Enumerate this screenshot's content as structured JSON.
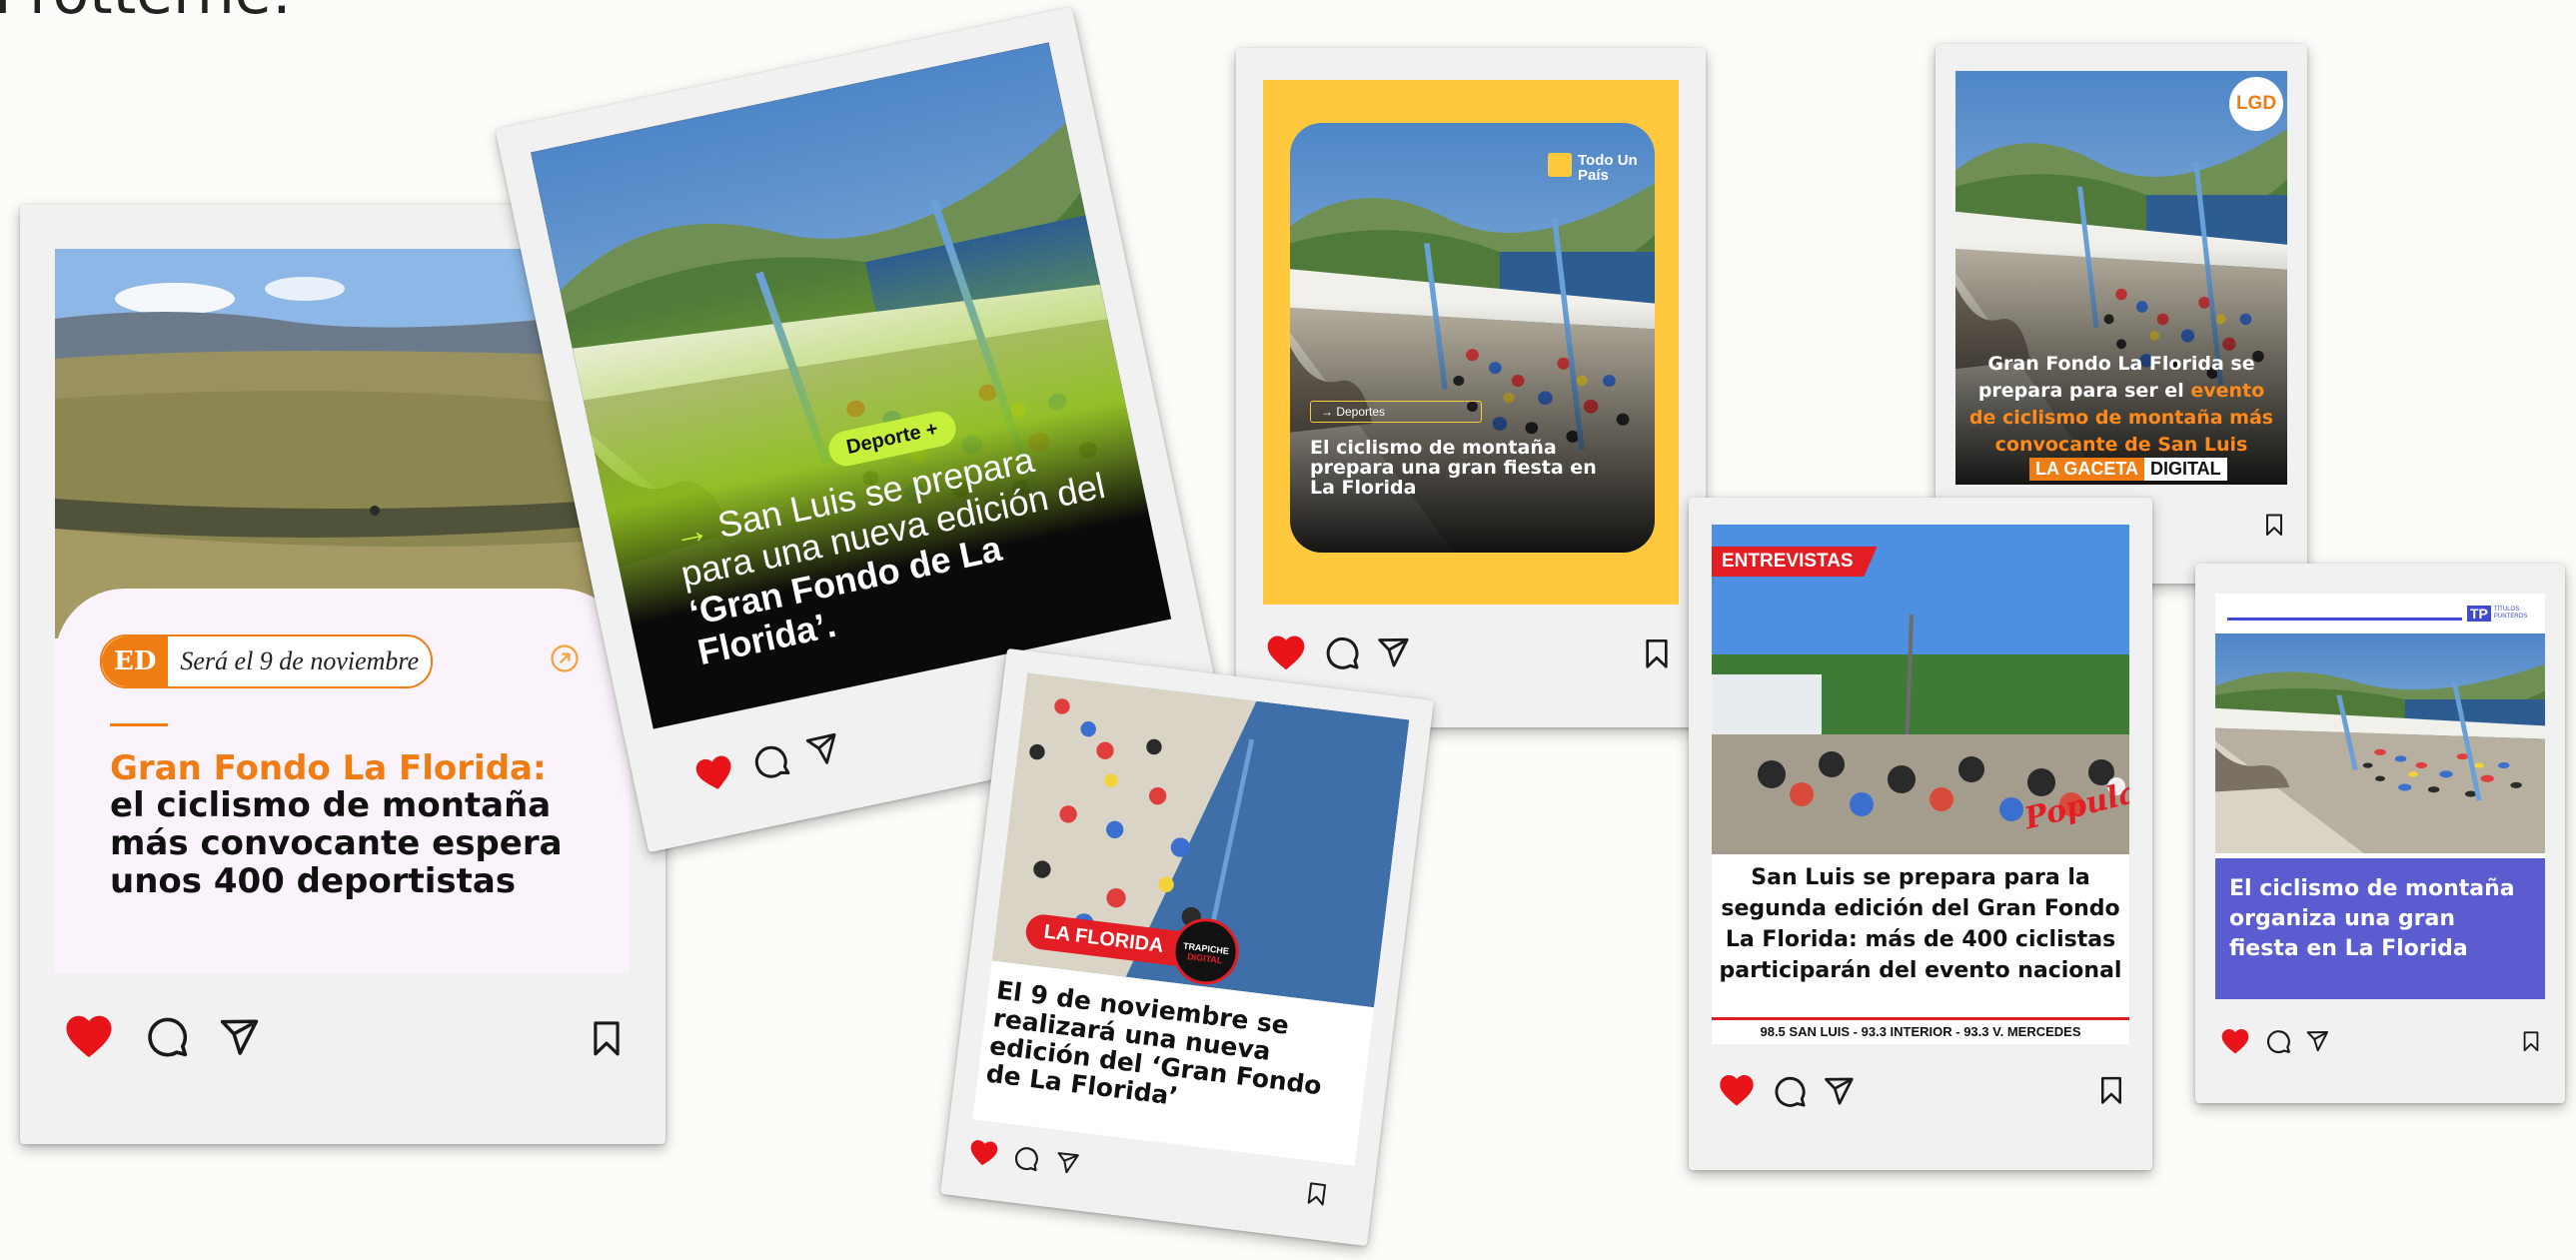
{
  "page": {
    "title": "Protterne:"
  },
  "colors": {
    "heart": "#e8141a",
    "orange": "#ef7d14",
    "yellow": "#ffc83d",
    "lime": "#c6f03c",
    "purple": "#5a5ccf",
    "red": "#e31d24"
  },
  "icons": [
    "heart-icon",
    "comment-icon",
    "send-icon",
    "bookmark-icon",
    "external-link-icon"
  ],
  "posts": [
    {
      "outlet_badge": "ED",
      "subtitle": "Será el 9 de noviembre",
      "headline_accent": "Gran Fondo La Florida:",
      "headline": "el ciclismo de montaña más convocante espera unos 400 deportistas"
    },
    {
      "tag": "Deporte +",
      "arrow": "→",
      "headline": "San Luis se prepara para una nueva edición del",
      "headline_accent": "‘Gran Fondo de La Florida’."
    },
    {
      "brand": "Todo Un País",
      "tag": "→ Deportes",
      "headline": "El ciclismo de montaña prepara una gran fiesta en La Florida"
    },
    {
      "logo": "LGD",
      "headline_part1": "Gran Fondo La Florida se prepara para ser el",
      "headline_accent": "evento de ciclismo de montaña más convocante de San Luis",
      "footer_brand_1": "LA GACETA",
      "footer_brand_2": "DIGITAL"
    },
    {
      "tag": "LA FLORIDA",
      "logo_line1": "TRAPICHE",
      "logo_line2": "DIGITAL",
      "headline": "El 9 de noviembre se realizará una nueva edición del ‘Gran Fondo de La Florida’"
    },
    {
      "tag": "ENTREVISTAS",
      "watermark": "Popular",
      "headline": "San Luis se prepara para la segunda edición del Gran Fondo La Florida: más de 400 ciclistas participarán del evento nacional",
      "footer": "98.5 SAN LUIS  - 93.3 INTERIOR - 93.3 V. MERCEDES"
    },
    {
      "logo": "TP",
      "logo_text": "TÍTULOS PUNTEROS",
      "headline": "El ciclismo de montaña organiza una gran fiesta en La Florida"
    }
  ]
}
